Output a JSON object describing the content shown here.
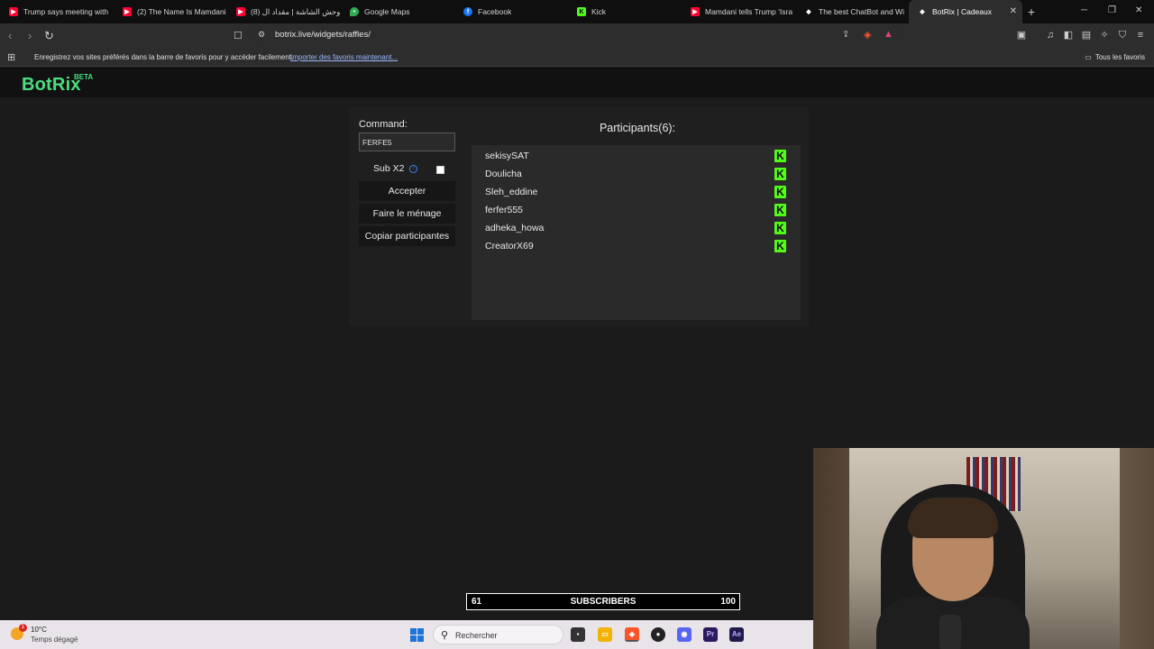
{
  "browser": {
    "tabs": [
      {
        "title": "Trump says meeting with",
        "favicon": "youtube-icon",
        "color": "#ff0033"
      },
      {
        "title": "(2) The Name Is Mamdani",
        "favicon": "youtube-icon",
        "color": "#ff0033"
      },
      {
        "title": "(8) وحش الشاشة | مقداد ال",
        "favicon": "youtube-icon",
        "color": "#ff0033"
      },
      {
        "title": "Google Maps",
        "favicon": "maps-icon",
        "color": "#34a853"
      },
      {
        "title": "Facebook",
        "favicon": "facebook-icon",
        "color": "#1877f2"
      },
      {
        "title": "Kick",
        "favicon": "kick-icon",
        "color": "#53fc18"
      },
      {
        "title": "Mamdani tells Trump 'Isra",
        "favicon": "youtube-icon",
        "color": "#ff0033"
      },
      {
        "title": "The best ChatBot and Wi",
        "favicon": "botrix-icon",
        "color": "#ffffff"
      },
      {
        "title": "BotRix | Cadeaux",
        "favicon": "botrix-icon",
        "color": "#ffffff"
      }
    ],
    "url": "botrix.live/widgets/raffles/",
    "bookmarks_message": "Enregistrez vos sites préférés dans la barre de favoris pour y accéder facilement.",
    "bookmarks_link": "Importer des favoris maintenant...",
    "all_bookmarks": "Tous les favoris"
  },
  "site": {
    "logo": "BotRix",
    "beta": "BETA"
  },
  "raffle": {
    "command_label": "Command:",
    "command_value": "FERFE5",
    "sub_label": "Sub X2",
    "sub_checked": false,
    "buttons": {
      "accept": "Accepter",
      "clear": "Faire le ménage",
      "copy": "Copiar participantes"
    },
    "participants_title": "Participants(6):",
    "participants": [
      "sekisySAT",
      "Doulicha",
      "Sleh_eddine",
      "ferfer555",
      "adheka_howa",
      "CreatorX69"
    ]
  },
  "overlay": {
    "sub_current": "61",
    "sub_label": "SUBSCRIBERS",
    "sub_goal": "100"
  },
  "taskbar": {
    "temperature": "10°C",
    "weather": "Temps dégagé",
    "weather_badge": "1",
    "search_placeholder": "Rechercher"
  },
  "colors": {
    "accent": "#4ade80",
    "kick": "#53fc18"
  }
}
